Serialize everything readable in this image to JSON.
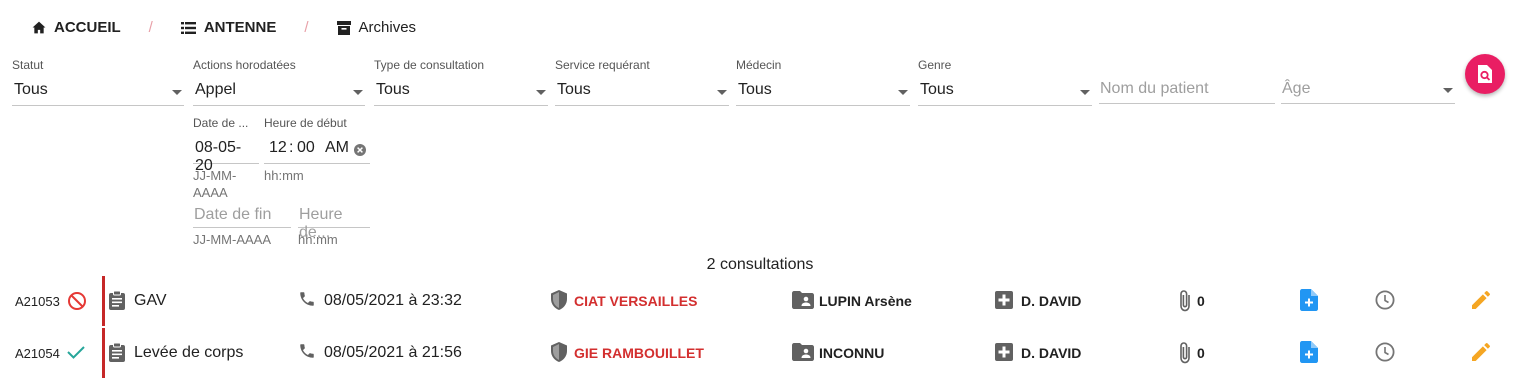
{
  "breadcrumb": {
    "home": "ACCUEIL",
    "antenne": "ANTENNE",
    "archives": "Archives",
    "separator": "/"
  },
  "filters": {
    "statut": {
      "label": "Statut",
      "value": "Tous"
    },
    "actions": {
      "label": "Actions horodatées",
      "value": "Appel"
    },
    "type": {
      "label": "Type de consultation",
      "value": "Tous"
    },
    "service": {
      "label": "Service requérant",
      "value": "Tous"
    },
    "medecin": {
      "label": "Médecin",
      "value": "Tous"
    },
    "genre": {
      "label": "Genre",
      "value": "Tous"
    },
    "patient": {
      "placeholder": "Nom du patient"
    },
    "age": {
      "placeholder": "Âge"
    },
    "date_debut": {
      "label": "Date de ...",
      "value": "08-05-20",
      "hint": "JJ-MM-AAAA"
    },
    "heure_debut": {
      "label": "Heure de début",
      "hh": "12",
      "colon": ":",
      "mm": "00",
      "ampm": "AM",
      "hint": "hh:mm"
    },
    "date_fin": {
      "placeholder": "Date de fin",
      "hint": "JJ-MM-AAAA"
    },
    "heure_fin": {
      "placeholder": "Heure de...",
      "hint": "hh:mm"
    }
  },
  "summary": "2 consultations",
  "rows": [
    {
      "id": "A21053",
      "status_icon": "block-icon",
      "type": "GAV",
      "datetime": "08/05/2021 à 23:32",
      "service": "CIAT VERSAILLES",
      "patient": "LUPIN Arsène",
      "doctor": "D. DAVID",
      "attachments": "0"
    },
    {
      "id": "A21054",
      "status_icon": "check-icon",
      "type": "Levée de corps",
      "datetime": "08/05/2021 à 21:56",
      "service": "GIE RAMBOUILLET",
      "patient": "INCONNU",
      "doctor": "D. DAVID",
      "attachments": "0"
    }
  ],
  "colors": {
    "accent": "#e91e63",
    "service": "#d32f2f",
    "status_bar": "#c62828",
    "doc_icon": "#2196f3",
    "edit_icon": "#f5a623",
    "ok": "#26a69a",
    "blocked": "#e53935"
  }
}
